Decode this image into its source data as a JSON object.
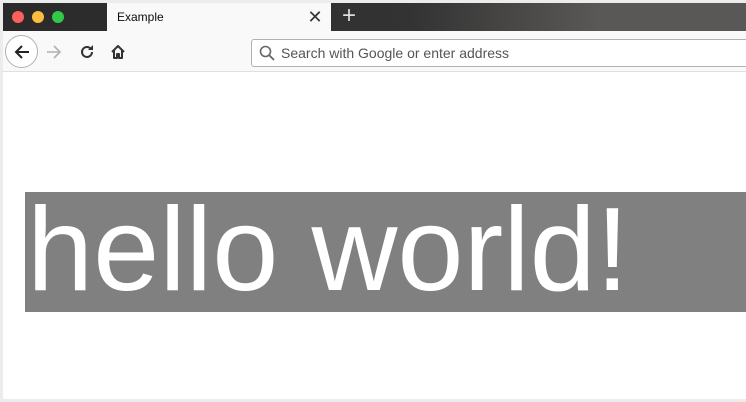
{
  "window": {
    "traffic_lights": {
      "close": "#fc605c",
      "minimize": "#fdbc40",
      "maximize": "#34c84a"
    }
  },
  "tabs": [
    {
      "title": "Example",
      "active": true
    }
  ],
  "toolbar": {
    "url_placeholder": "Search with Google or enter address"
  },
  "page": {
    "heading": "hello world!",
    "heading_background": "#808080",
    "heading_color": "#ffffff"
  }
}
